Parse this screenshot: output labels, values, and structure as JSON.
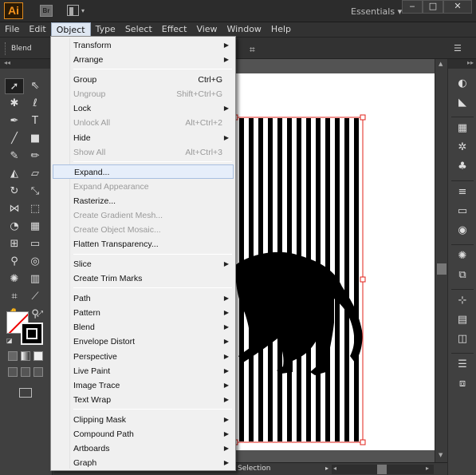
{
  "titlebar": {
    "app_logo": "Ai",
    "bridge_label": "Br",
    "workspace": "Essentials",
    "workspace_arrow": "▾",
    "minimize": "‒",
    "maximize": "□",
    "close": "✕"
  },
  "menubar": {
    "items": [
      "File",
      "Edit",
      "Object",
      "Type",
      "Select",
      "Effect",
      "View",
      "Window",
      "Help"
    ],
    "active": "Object"
  },
  "controlbar": {
    "label": "Blend"
  },
  "object_menu": {
    "items": [
      {
        "label": "Transform",
        "shortcut": "",
        "submenu": true,
        "enabled": true
      },
      {
        "label": "Arrange",
        "shortcut": "",
        "submenu": true,
        "enabled": true
      },
      {
        "label": "Group",
        "shortcut": "Ctrl+G",
        "submenu": false,
        "enabled": true
      },
      {
        "label": "Ungroup",
        "shortcut": "Shift+Ctrl+G",
        "submenu": false,
        "enabled": false
      },
      {
        "label": "Lock",
        "shortcut": "",
        "submenu": true,
        "enabled": true
      },
      {
        "label": "Unlock All",
        "shortcut": "Alt+Ctrl+2",
        "submenu": false,
        "enabled": false
      },
      {
        "label": "Hide",
        "shortcut": "",
        "submenu": true,
        "enabled": true
      },
      {
        "label": "Show All",
        "shortcut": "Alt+Ctrl+3",
        "submenu": false,
        "enabled": false
      },
      {
        "label": "Expand...",
        "shortcut": "",
        "submenu": false,
        "enabled": true,
        "highlighted": true
      },
      {
        "label": "Expand Appearance",
        "shortcut": "",
        "submenu": false,
        "enabled": false
      },
      {
        "label": "Rasterize...",
        "shortcut": "",
        "submenu": false,
        "enabled": true
      },
      {
        "label": "Create Gradient Mesh...",
        "shortcut": "",
        "submenu": false,
        "enabled": false
      },
      {
        "label": "Create Object Mosaic...",
        "shortcut": "",
        "submenu": false,
        "enabled": false
      },
      {
        "label": "Flatten Transparency...",
        "shortcut": "",
        "submenu": false,
        "enabled": true
      },
      {
        "label": "Slice",
        "shortcut": "",
        "submenu": true,
        "enabled": true
      },
      {
        "label": "Create Trim Marks",
        "shortcut": "",
        "submenu": false,
        "enabled": true
      },
      {
        "label": "Path",
        "shortcut": "",
        "submenu": true,
        "enabled": true
      },
      {
        "label": "Pattern",
        "shortcut": "",
        "submenu": true,
        "enabled": true
      },
      {
        "label": "Blend",
        "shortcut": "",
        "submenu": true,
        "enabled": true
      },
      {
        "label": "Envelope Distort",
        "shortcut": "",
        "submenu": true,
        "enabled": true
      },
      {
        "label": "Perspective",
        "shortcut": "",
        "submenu": true,
        "enabled": true
      },
      {
        "label": "Live Paint",
        "shortcut": "",
        "submenu": true,
        "enabled": true
      },
      {
        "label": "Image Trace",
        "shortcut": "",
        "submenu": true,
        "enabled": true
      },
      {
        "label": "Text Wrap",
        "shortcut": "",
        "submenu": true,
        "enabled": true
      },
      {
        "label": "Clipping Mask",
        "shortcut": "",
        "submenu": true,
        "enabled": true
      },
      {
        "label": "Compound Path",
        "shortcut": "",
        "submenu": true,
        "enabled": true
      },
      {
        "label": "Artboards",
        "shortcut": "",
        "submenu": true,
        "enabled": true
      },
      {
        "label": "Graph",
        "shortcut": "",
        "submenu": true,
        "enabled": true
      }
    ]
  },
  "statusbar": {
    "tool": "Selection"
  },
  "colors": {
    "menu_highlight": "#e6eefa",
    "selection_bounds": "#e0201a",
    "logo": "#f7941d"
  }
}
